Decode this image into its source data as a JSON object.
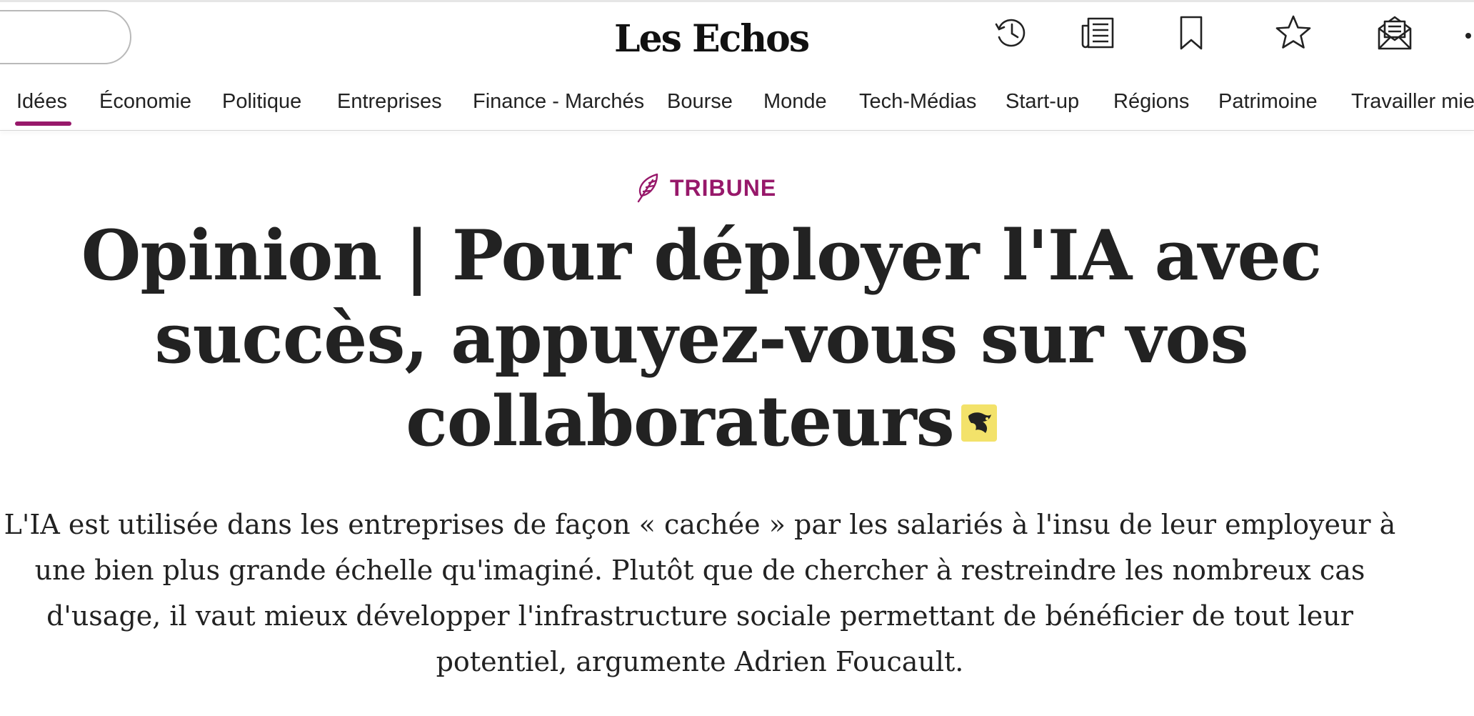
{
  "header": {
    "logo": "Les Echos",
    "icons": [
      "history-icon",
      "newspaper-icon",
      "bookmark-icon",
      "star-icon",
      "newsletter-icon"
    ]
  },
  "nav": {
    "items": [
      {
        "label": "Idées",
        "active": true
      },
      {
        "label": "Économie"
      },
      {
        "label": "Politique"
      },
      {
        "label": "Entreprises"
      },
      {
        "label": "Finance - Marchés"
      },
      {
        "label": "Bourse"
      },
      {
        "label": "Monde"
      },
      {
        "label": "Tech-Médias"
      },
      {
        "label": "Start-up"
      },
      {
        "label": "Régions"
      },
      {
        "label": "Patrimoine"
      },
      {
        "label": "Travailler mieu"
      }
    ]
  },
  "article": {
    "kicker": "TRIBUNE",
    "title": "Opinion | Pour déployer l'IA avec succès, appuyez-vous sur vos collaborateurs",
    "chapo": "L'IA est utilisée dans les entreprises de façon « cachée » par les salariés à l'insu de leur employeur à une bien plus grande échelle qu'imaginé. Plutôt que de chercher à restreindre les nombreux cas d'usage, il vaut mieux développer l'infrastructure sociale permettant de bénéficier de tout leur potentiel, argumente Adrien Foucault."
  },
  "colors": {
    "accent": "#97186a",
    "premium_badge": "#f3e26a",
    "text": "#222222"
  }
}
